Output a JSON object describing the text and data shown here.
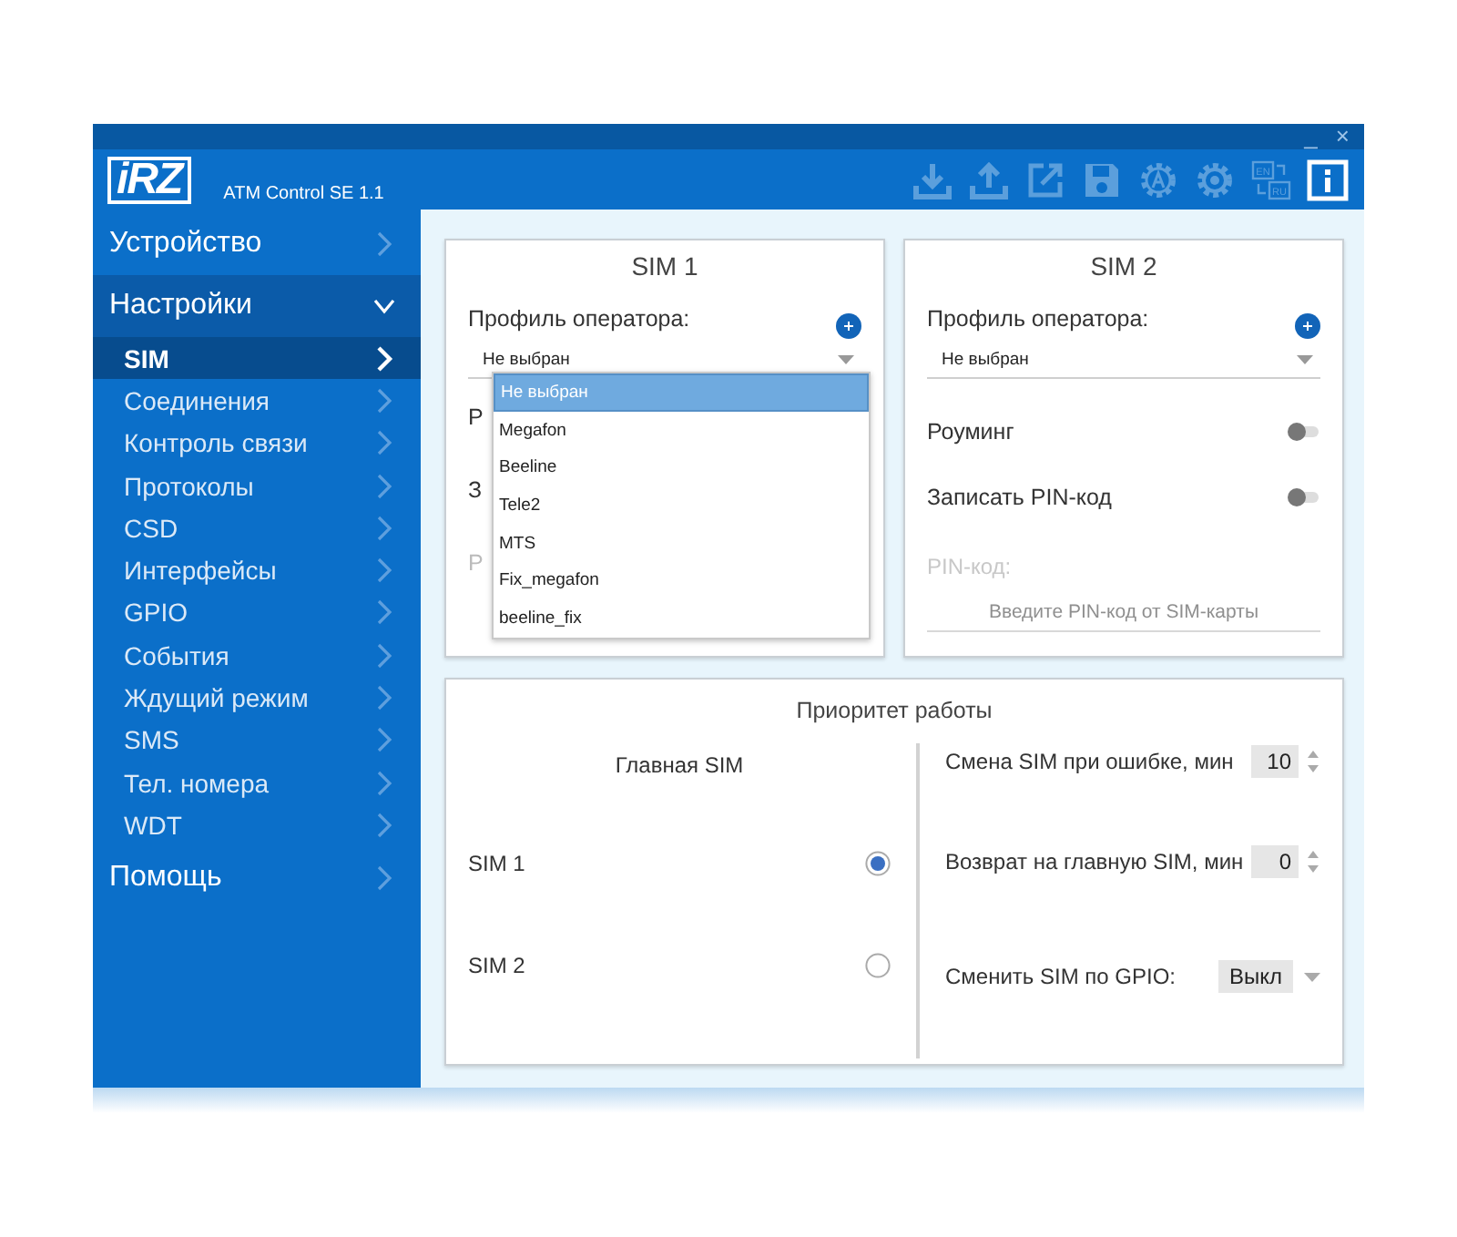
{
  "window": {
    "title_bar_buttons": [
      "_",
      "×"
    ],
    "app_title": "ATM Control SE 1.1",
    "logo": "iRZ"
  },
  "toolbar": [
    {
      "kind": "download",
      "active": false
    },
    {
      "kind": "upload",
      "active": false
    },
    {
      "kind": "export",
      "active": false
    },
    {
      "kind": "save",
      "active": false
    },
    {
      "kind": "auto-gear",
      "active": false
    },
    {
      "kind": "gear",
      "active": false
    },
    {
      "kind": "language",
      "active": false,
      "labels": [
        "EN",
        "RU"
      ]
    },
    {
      "kind": "info",
      "active": true
    }
  ],
  "sidebar": {
    "items": [
      {
        "label": "Устройство",
        "expanded": false
      },
      {
        "label": "Настройки",
        "expanded": true,
        "children": [
          {
            "label": "SIM",
            "selected": true
          },
          {
            "label": "Соединения",
            "selected": false
          },
          {
            "label": "Контроль связи",
            "selected": false
          },
          {
            "label": "Протоколы",
            "selected": false
          },
          {
            "label": "CSD",
            "selected": false
          },
          {
            "label": "Интерфейсы",
            "selected": false
          },
          {
            "label": "GPIO",
            "selected": false
          },
          {
            "label": "События",
            "selected": false
          },
          {
            "label": "Ждущий режим",
            "selected": false
          },
          {
            "label": "SMS",
            "selected": false
          },
          {
            "label": "Тел. номера",
            "selected": false
          },
          {
            "label": "WDT",
            "selected": false
          }
        ]
      },
      {
        "label": "Помощь",
        "expanded": false
      }
    ]
  },
  "sim_cards": [
    {
      "title": "SIM 1",
      "profile_label": "Профиль оператора:",
      "profile_value": "Не выбран",
      "covered_labels": [
        {
          "text": "Р",
          "disabled": false
        },
        {
          "text": "З",
          "disabled": false
        },
        {
          "text": "Р",
          "disabled": true
        }
      ],
      "dropdown": {
        "options": [
          {
            "label": "Не выбран",
            "selected": true
          },
          {
            "label": "Megafon",
            "selected": false
          },
          {
            "label": "Beeline",
            "selected": false
          },
          {
            "label": "Tele2",
            "selected": false
          },
          {
            "label": "MTS",
            "selected": false
          },
          {
            "label": "Fix_megafon",
            "selected": false
          },
          {
            "label": "beeline_fix",
            "selected": false
          }
        ]
      }
    },
    {
      "title": "SIM 2",
      "profile_label": "Профиль оператора:",
      "profile_value": "Не выбран",
      "toggles": [
        {
          "label": "Роуминг",
          "on": false
        },
        {
          "label": "Записать PIN-код",
          "on": false
        }
      ],
      "pin": {
        "label": "PIN-код:",
        "placeholder": "Введите PIN-код от SIM-карты",
        "disabled": true
      }
    }
  ],
  "priority": {
    "title": "Приоритет работы",
    "main_sim_title": "Главная SIM",
    "main_sim_options": [
      {
        "label": "SIM 1",
        "selected": true
      },
      {
        "label": "SIM 2",
        "selected": false
      }
    ],
    "settings": [
      {
        "kind": "spinner",
        "label": "Смена SIM при ошибке, мин",
        "value": "10"
      },
      {
        "kind": "spinner",
        "label": "Возврат на главную SIM, мин",
        "value": "0"
      },
      {
        "kind": "select",
        "label": "Сменить SIM по GPIO:",
        "value": "Выкл"
      }
    ]
  }
}
